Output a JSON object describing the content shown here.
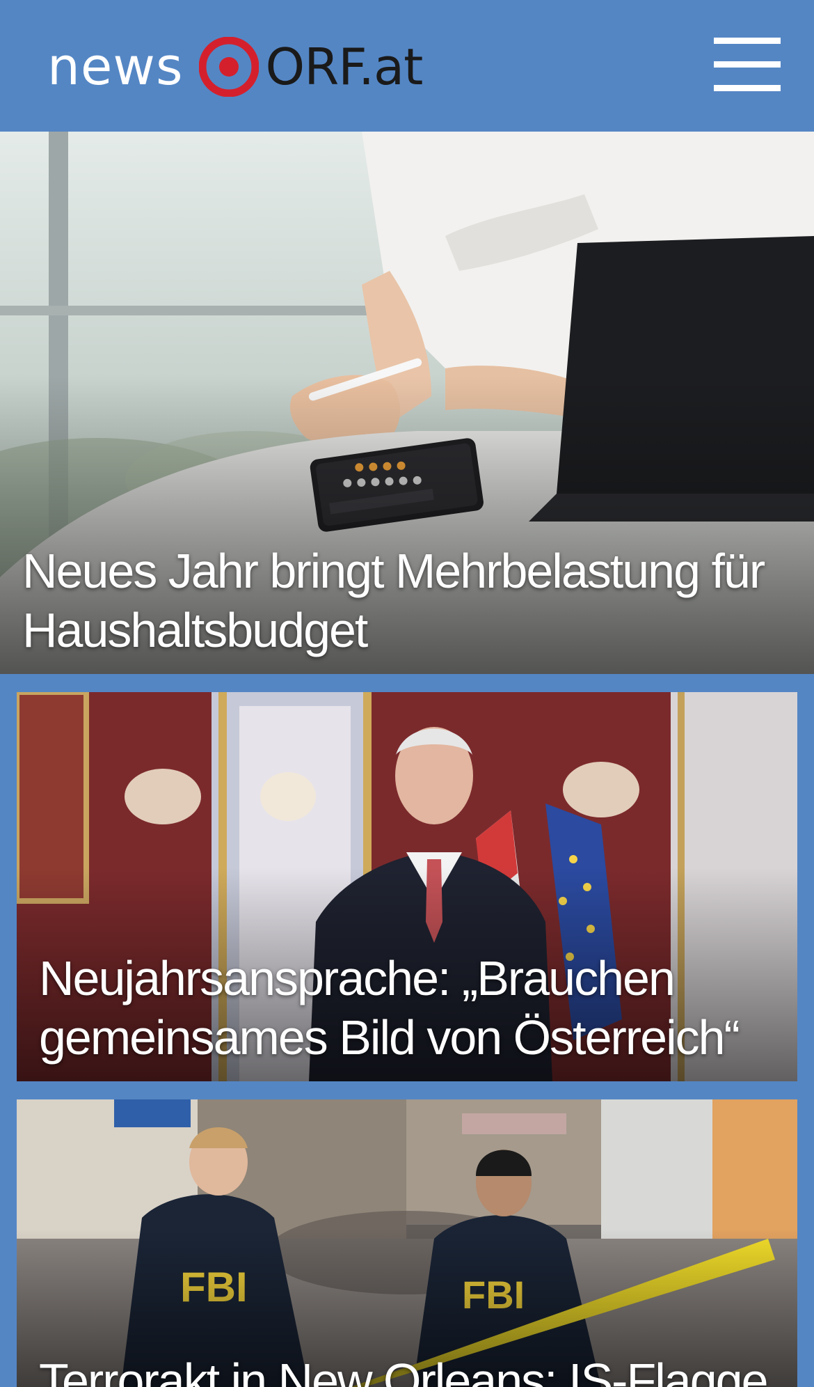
{
  "header": {
    "logo_news": "news",
    "logo_orf": "ORF.at",
    "logo_eye_icon": "orf-eye-icon",
    "menu_icon": "hamburger-menu-icon",
    "background_color": "#5486c4"
  },
  "articles": [
    {
      "headline": "Neues Jahr bringt Mehrbelastung für Haushaltsbudget",
      "image": "calculator-and-tablet-photo"
    },
    {
      "headline": "Neujahrsansprache: „Brauchen gemeinsames Bild von Österreich“",
      "image": "president-in-palace-photo"
    },
    {
      "headline": "Terrorakt in New Orleans: IS-Flagge",
      "image": "fbi-agents-street-photo"
    }
  ],
  "colors": {
    "brand_blue": "#5486c4",
    "orf_red": "#d4202c"
  }
}
